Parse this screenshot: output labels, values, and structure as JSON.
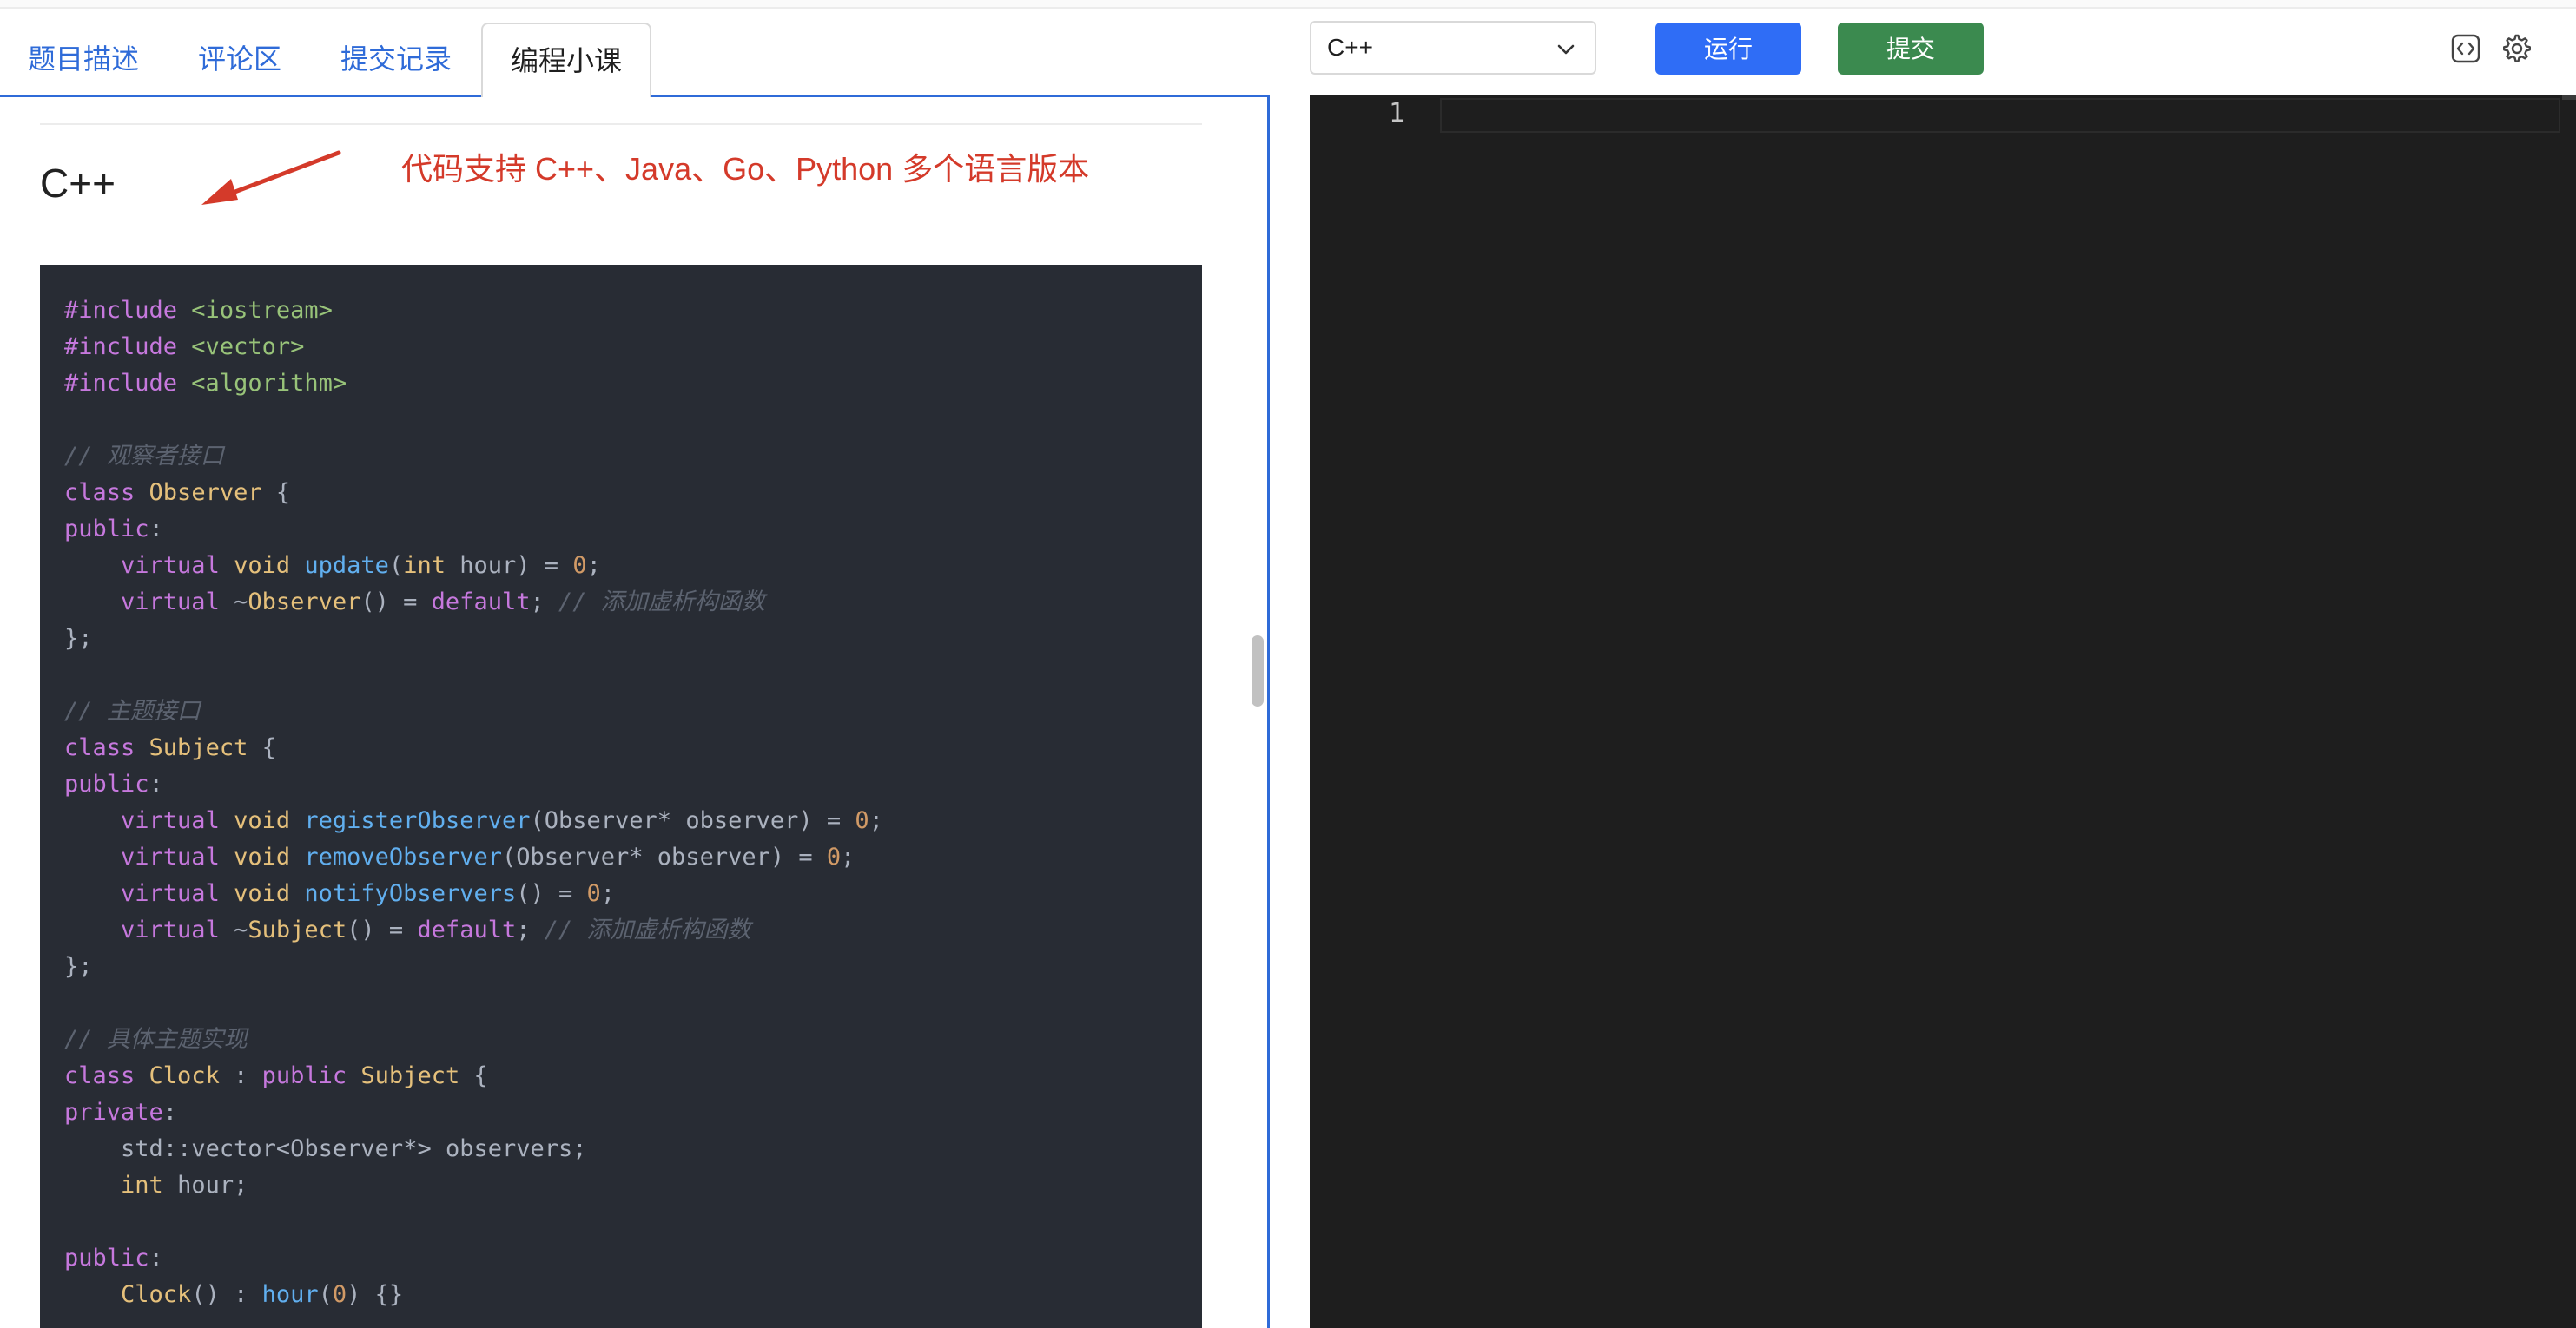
{
  "tabs": [
    {
      "label": "题目描述",
      "active": false
    },
    {
      "label": "评论区",
      "active": false
    },
    {
      "label": "提交记录",
      "active": false
    },
    {
      "label": "编程小课",
      "active": true
    }
  ],
  "content": {
    "section_heading": "C++",
    "annotation": "代码支持 C++、Java、Go、Python 多个语言版本",
    "annotation_color": "#d43a2a",
    "code_lines": [
      "#include <iostream>",
      "#include <vector>",
      "#include <algorithm>",
      "",
      "// 观察者接口",
      "class Observer {",
      "public:",
      "    virtual void update(int hour) = 0;",
      "    virtual ~Observer() = default; // 添加虚析构函数",
      "};",
      "",
      "// 主题接口",
      "class Subject {",
      "public:",
      "    virtual void registerObserver(Observer* observer) = 0;",
      "    virtual void removeObserver(Observer* observer) = 0;",
      "    virtual void notifyObservers() = 0;",
      "    virtual ~Subject() = default; // 添加虚析构函数",
      "};",
      "",
      "// 具体主题实现",
      "class Clock : public Subject {",
      "private:",
      "    std::vector<Observer*> observers;",
      "    int hour;",
      "",
      "public:",
      "    Clock() : hour(0) {}"
    ]
  },
  "toolbar": {
    "language": "C++",
    "run_label": "运行",
    "submit_label": "提交",
    "run_color": "#2f6df6",
    "submit_color": "#3b8a4f"
  },
  "editor": {
    "line_numbers": [
      "1"
    ],
    "content": ""
  },
  "icons": {
    "code": "code-brackets-icon",
    "settings": "gear-icon",
    "dropdown": "chevron-down-icon",
    "arrow": "red-arrow-icon"
  }
}
